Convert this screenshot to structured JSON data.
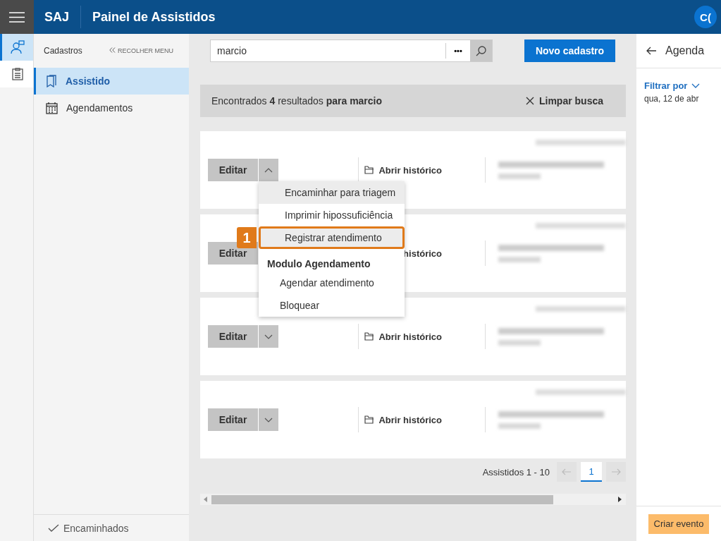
{
  "topbar": {
    "product": "SAJ",
    "title": "Painel de Assistidos",
    "avatar": "C("
  },
  "rail": [
    {
      "selected": true
    },
    {
      "selected": false
    }
  ],
  "sidebar": {
    "header": "Cadastros",
    "collapse": "RECOLHER MENU",
    "items": [
      {
        "label": "Assistido",
        "selected": true
      },
      {
        "label": "Agendamentos",
        "selected": false
      }
    ],
    "footer": "Encaminhados"
  },
  "search": {
    "value": "marcio",
    "more": "•••"
  },
  "new_button": "Novo cadastro",
  "results": {
    "text": "Encontrados **4** resultados **para marcio**",
    "clear": "Limpar busca"
  },
  "cards": [
    {
      "kind": "full",
      "edit": "Editar",
      "expanded": true,
      "history": "Abrir histórico"
    },
    {
      "kind": "clipped",
      "edit": "Editar",
      "expanded": false,
      "history": "histórico"
    },
    {
      "kind": "full",
      "edit": "Editar",
      "expanded": false,
      "history": "Abrir histórico"
    },
    {
      "kind": "full",
      "edit": "Editar",
      "expanded": false,
      "history": "Abrir histórico"
    }
  ],
  "menu": [
    {
      "kind": "item",
      "label": "Encaminhar para triagem",
      "highlighted": true
    },
    {
      "kind": "item",
      "label": "Imprimir hipossuficiência",
      "highlighted": false
    },
    {
      "kind": "item",
      "label": "Registrar atendimento",
      "highlighted": true,
      "callout": "1"
    },
    {
      "kind": "heading",
      "label": "Modulo Agendamento"
    },
    {
      "kind": "subitem",
      "label": "Agendar atendimento",
      "highlighted": false
    },
    {
      "kind": "subitem",
      "label": "Bloquear",
      "highlighted": false
    }
  ],
  "pagination": {
    "range": "Assistidos 1 - 10",
    "pages": [
      {
        "label": "1",
        "selected": true
      }
    ]
  },
  "agenda": {
    "title": "Agenda",
    "filter": "Filtrar por",
    "date": "qua, 12 de abr",
    "create": "Criar evento"
  }
}
